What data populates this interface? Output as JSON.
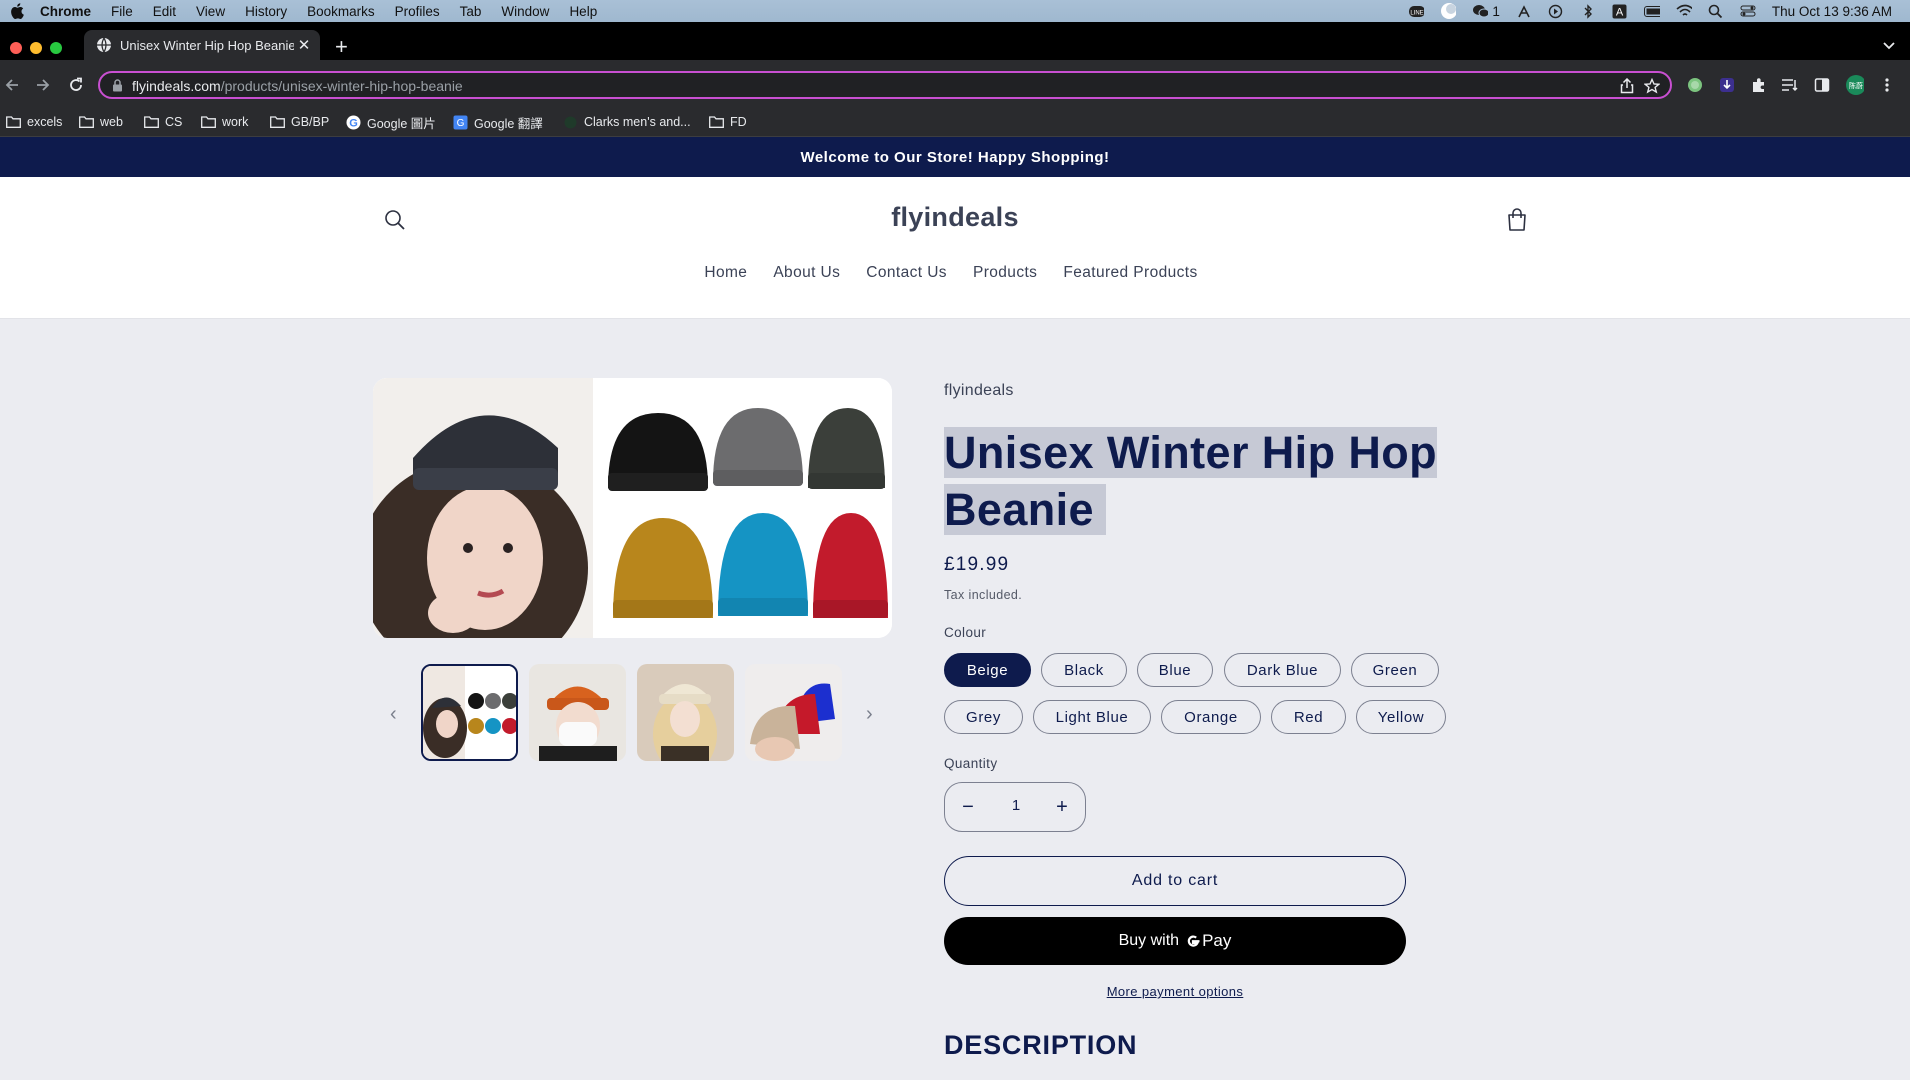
{
  "mac_menu": {
    "app": "Chrome",
    "items": [
      "File",
      "Edit",
      "View",
      "History",
      "Bookmarks",
      "Profiles",
      "Tab",
      "Window",
      "Help"
    ],
    "wechat_count": "1",
    "datetime": "Thu Oct 13  9:36 AM"
  },
  "browser": {
    "tab_title": "Unisex Winter Hip Hop Beanie",
    "url_host": "flyindeals.com",
    "url_path": "/products/unisex-winter-hip-hop-beanie",
    "profile_initials": "陈蔚",
    "bookmarks": [
      "excels",
      "web",
      "CS",
      "work",
      "GB/BP",
      "Google 圖片",
      "Google 翻譯",
      "Clarks men's and...",
      "FD"
    ]
  },
  "store": {
    "announcement": "Welcome to Our Store! Happy Shopping!",
    "logo": "flyindeals",
    "nav": [
      "Home",
      "About Us",
      "Contact Us",
      "Products",
      "Featured Products"
    ]
  },
  "product": {
    "vendor": "flyindeals",
    "title": "Unisex Winter Hip Hop Beanie",
    "price": "£19.99",
    "tax_note": "Tax included.",
    "colour_label": "Colour",
    "colours": [
      "Beige",
      "Black",
      "Blue",
      "Dark Blue",
      "Green",
      "Grey",
      "Light Blue",
      "Orange",
      "Red",
      "Yellow"
    ],
    "selected_colour": "Beige",
    "quantity_label": "Quantity",
    "quantity": "1",
    "add_to_cart": "Add to cart",
    "buy_with": "Buy with",
    "pay_brand": "Pay",
    "more_payment": "More payment options",
    "description_heading": "DESCRIPTION"
  },
  "colors": {
    "accent": "#0e1b4d",
    "page_bg": "#ebecf1",
    "omnibox_border": "#c84fd1"
  }
}
